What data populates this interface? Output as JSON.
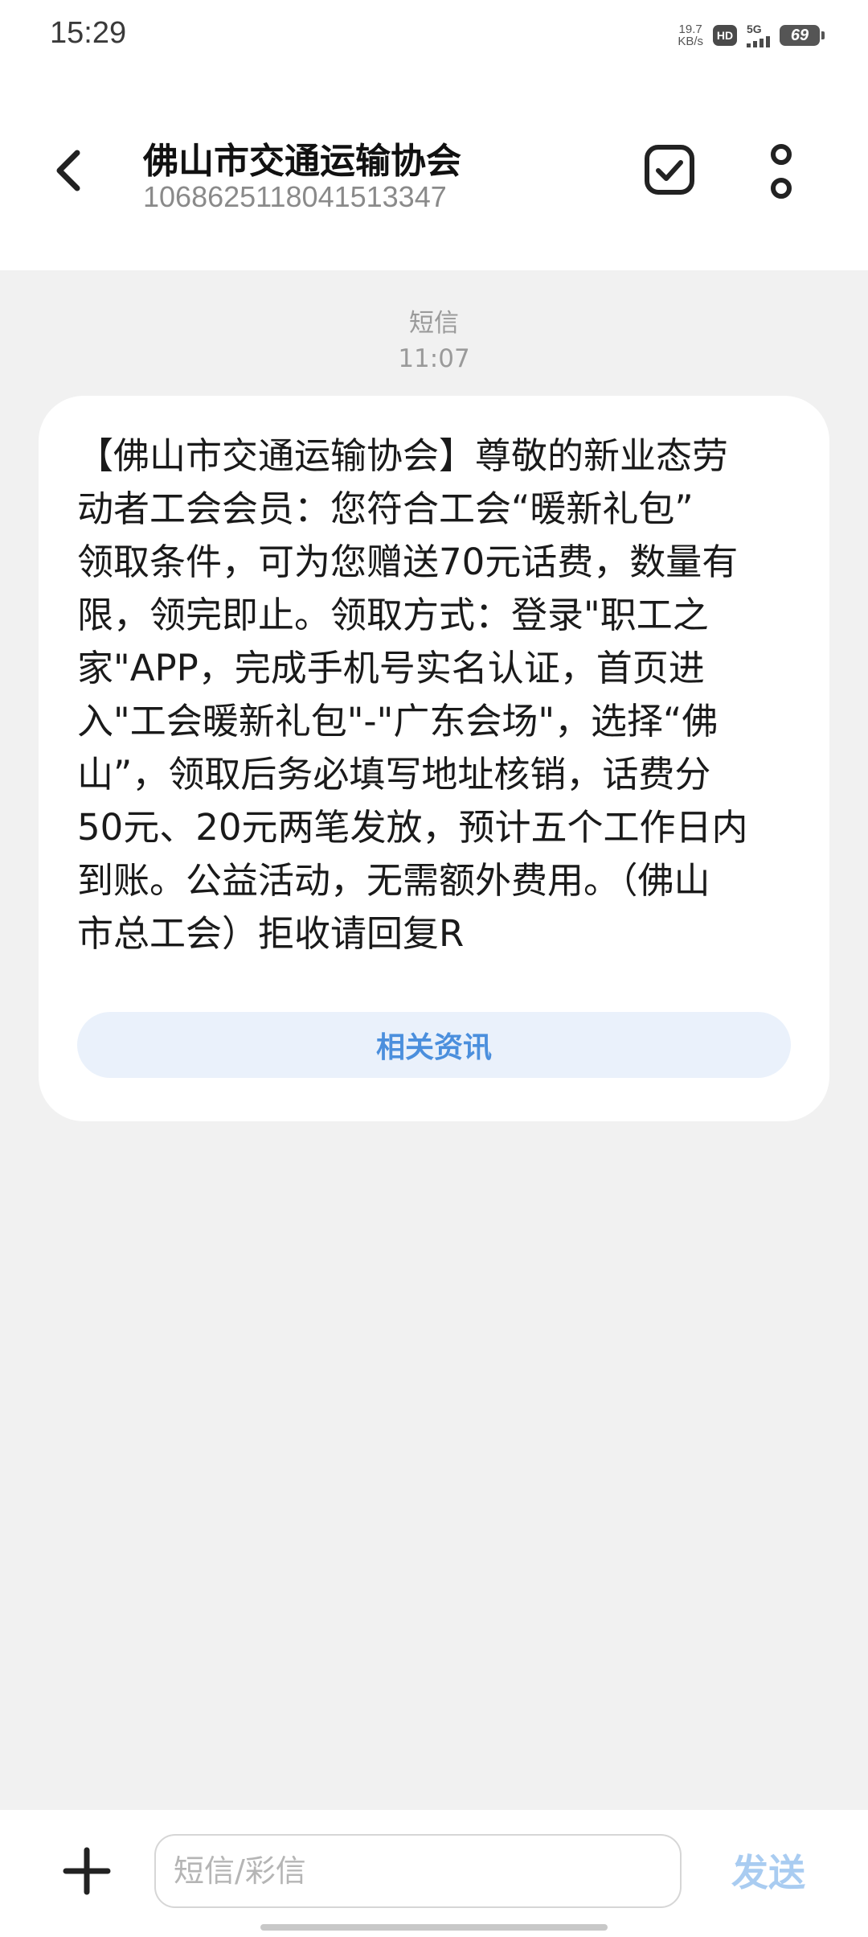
{
  "status_bar": {
    "time": "15:29",
    "net_speed_value": "19.7",
    "net_speed_unit": "KB/s",
    "hd_label": "HD",
    "network_label": "5G",
    "battery_level": "69"
  },
  "header": {
    "sender_name": "佛山市交通运输协会",
    "sender_number": "1068625118041513347"
  },
  "message": {
    "type_label": "短信",
    "time": "11:07",
    "body": "【佛山市交通运输协会】尊敬的新业态劳\n动者工会会员：您符合工会“暖新礼包”\n领取条件，可为您赠送70元话费，数量有\n限，领完即止。领取方式：登录\"职工之\n家\"APP，完成手机号实名认证，首页进\n入\"工会暖新礼包\"-\"广东会场\"，选择“佛\n山”，领取后务必填写地址核销，话费分\n50元、20元两笔发放，预计五个工作日内\n到账。公益活动，无需额外费用。（佛山\n市总工会）拒收请回复R",
    "related_button_label": "相关资讯"
  },
  "compose": {
    "placeholder": "短信/彩信",
    "send_label": "发送"
  },
  "icons": {
    "back": "chevron-left-icon",
    "multi_select": "checkbox-icon",
    "more": "more-vertical-icon",
    "attach": "plus-icon"
  },
  "colors": {
    "accent": "#4b8fdd",
    "send_disabled": "#a9ccf1",
    "background": "#f1f1f1"
  }
}
